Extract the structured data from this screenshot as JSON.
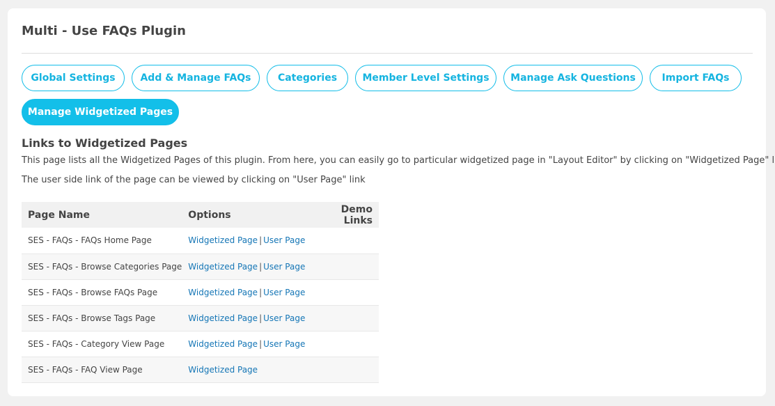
{
  "header": {
    "title": "Multi - Use FAQs Plugin"
  },
  "tabs": [
    {
      "label": "Global Settings"
    },
    {
      "label": "Add & Manage FAQs"
    },
    {
      "label": "Categories"
    },
    {
      "label": "Member Level Settings"
    },
    {
      "label": "Manage Ask Questions"
    },
    {
      "label": "Import FAQs"
    },
    {
      "label": "Manage Widgetized Pages",
      "active": true
    }
  ],
  "content": {
    "heading": "Links to Widgetized Pages",
    "description_1": "This page lists all the Widgetized Pages of this plugin. From here, you can easily go to particular widgetized page in \"Layout Editor\" by clicking on \"Widgetized Page\" link.",
    "description_2": "The user side link of the page can be viewed by clicking on \"User Page\" link"
  },
  "table": {
    "headers": [
      "Page Name",
      "Options",
      "Demo Links"
    ],
    "separator": "|",
    "rows": [
      {
        "page_name": "SES - FAQs - FAQs Home Page",
        "widgetized": "Widgetized Page",
        "user": "User Page"
      },
      {
        "page_name": "SES - FAQs - Browse Categories Page",
        "widgetized": "Widgetized Page",
        "user": "User Page"
      },
      {
        "page_name": "SES - FAQs - Browse FAQs Page",
        "widgetized": "Widgetized Page",
        "user": "User Page"
      },
      {
        "page_name": "SES - FAQs - Browse Tags Page",
        "widgetized": "Widgetized Page",
        "user": "User Page"
      },
      {
        "page_name": "SES - FAQs - Category View Page",
        "widgetized": "Widgetized Page",
        "user": "User Page"
      },
      {
        "page_name": "SES - FAQs - FAQ View Page",
        "widgetized": "Widgetized Page",
        "user": ""
      }
    ]
  },
  "colors": {
    "accent": "#13bfe9",
    "link": "#1576b6"
  }
}
